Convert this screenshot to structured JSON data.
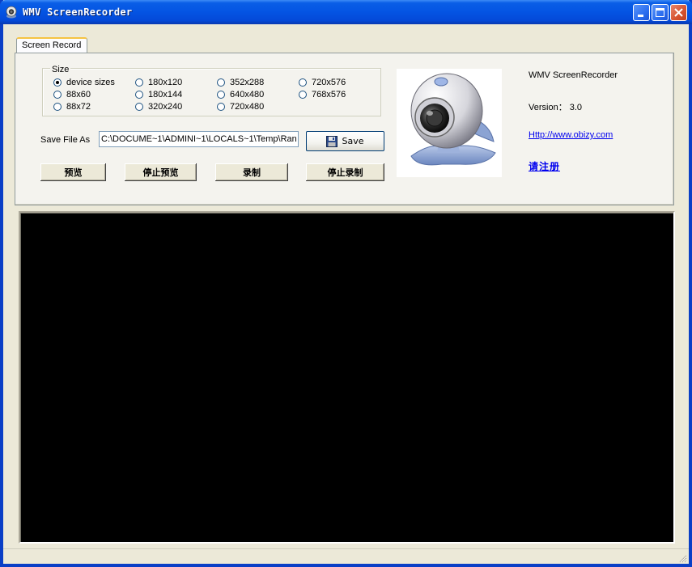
{
  "window": {
    "title": "WMV ScreenRecorder"
  },
  "tabs": [
    {
      "label": "Screen Record"
    }
  ],
  "size_group": {
    "label": "Size",
    "selected": "device sizes",
    "options": [
      "device sizes",
      "180x120",
      "352x288",
      "720x576",
      "88x60",
      "180x144",
      "640x480",
      "768x576",
      "88x72",
      "320x240",
      "720x480"
    ]
  },
  "save_file": {
    "label": "Save File As",
    "value": "C:\\DOCUME~1\\ADMINI~1\\LOCALS~1\\Temp\\Ran",
    "save_button": "Save"
  },
  "actions": {
    "preview": "预览",
    "stop_preview": "停止预览",
    "record": "录制",
    "stop_record": "停止录制"
  },
  "about": {
    "product": "WMV ScreenRecorder",
    "version": "Version： 3.0",
    "url": "Http://www.obizy.com",
    "register": "请注册"
  },
  "colors": {
    "title_bar": "#0454e3",
    "window_face": "#ece9d8",
    "preview_bg": "#000000",
    "link": "#0000ee"
  },
  "icons": [
    "webcam-icon",
    "minimize-icon",
    "maximize-icon",
    "close-icon",
    "floppy-disk-icon",
    "size-grip-icon"
  ]
}
